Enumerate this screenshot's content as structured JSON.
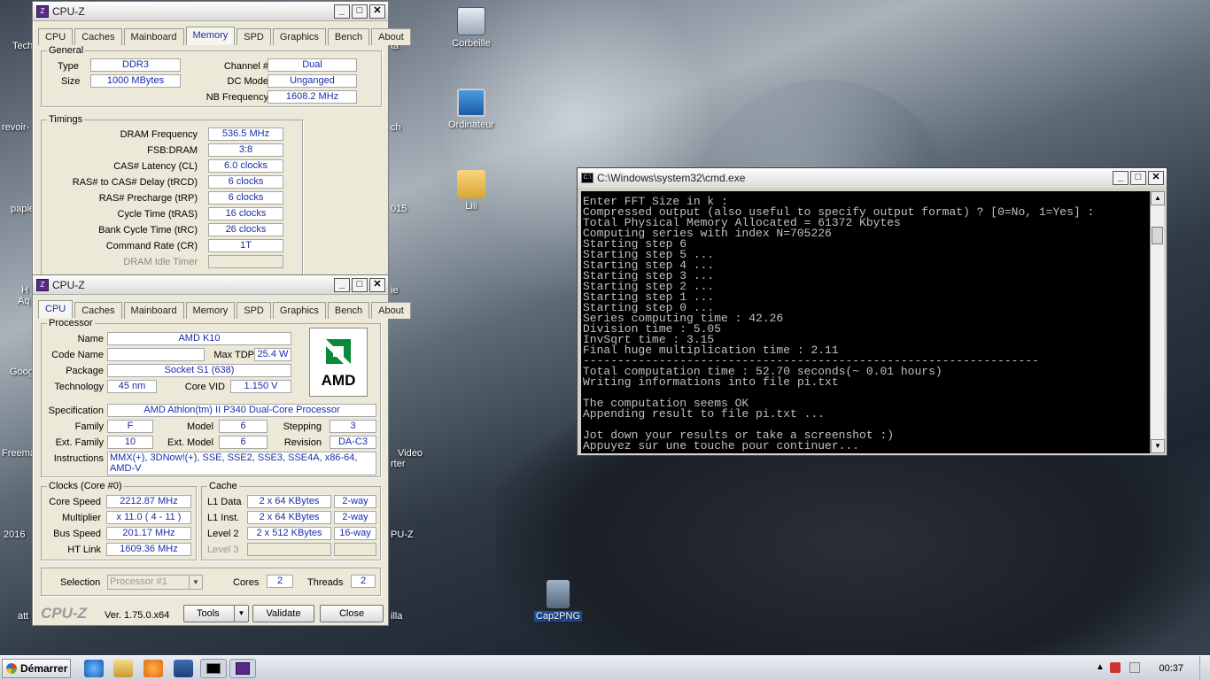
{
  "desktop": {
    "icons": [
      {
        "label": "Corbeille"
      },
      {
        "label": "Ordinateur"
      },
      {
        "label": "Lili"
      },
      {
        "label": "Cap2PNG"
      }
    ],
    "edge_labels": [
      "Tech",
      "revoir-",
      "papie",
      "H",
      "Aq",
      "Goog",
      "Freema",
      "2016",
      "att",
      "ta",
      "ch",
      "015",
      "ie",
      "Video",
      "rter",
      "PU-Z",
      "illa"
    ]
  },
  "cpuz_memory": {
    "title": "CPU-Z",
    "tabs": [
      "CPU",
      "Caches",
      "Mainboard",
      "Memory",
      "SPD",
      "Graphics",
      "Bench",
      "About"
    ],
    "active_tab": "Memory",
    "general": {
      "label": "General",
      "type_label": "Type",
      "type": "DDR3",
      "size_label": "Size",
      "size": "1000 MBytes",
      "channel_label": "Channel #",
      "channel": "Dual",
      "dcmode_label": "DC Mode",
      "dcmode": "Unganged",
      "nbfreq_label": "NB Frequency",
      "nbfreq": "1608.2 MHz"
    },
    "timings": {
      "label": "Timings",
      "rows": [
        {
          "label": "DRAM Frequency",
          "value": "536.5 MHz"
        },
        {
          "label": "FSB:DRAM",
          "value": "3:8"
        },
        {
          "label": "CAS# Latency (CL)",
          "value": "6.0 clocks"
        },
        {
          "label": "RAS# to CAS# Delay (tRCD)",
          "value": "6 clocks"
        },
        {
          "label": "RAS# Precharge (tRP)",
          "value": "6 clocks"
        },
        {
          "label": "Cycle Time (tRAS)",
          "value": "16 clocks"
        },
        {
          "label": "Bank Cycle Time (tRC)",
          "value": "26 clocks"
        },
        {
          "label": "Command Rate (CR)",
          "value": "1T"
        },
        {
          "label": "DRAM Idle Timer",
          "value": ""
        }
      ]
    }
  },
  "cpuz_cpu": {
    "title": "CPU-Z",
    "tabs": [
      "CPU",
      "Caches",
      "Mainboard",
      "Memory",
      "SPD",
      "Graphics",
      "Bench",
      "About"
    ],
    "active_tab": "CPU",
    "processor": {
      "label": "Processor",
      "name_label": "Name",
      "name": "AMD K10",
      "codename_label": "Code Name",
      "codename": "",
      "maxtdp_label": "Max TDP",
      "maxtdp": "25.4 W",
      "package_label": "Package",
      "package": "Socket S1 (638)",
      "technology_label": "Technology",
      "technology": "45 nm",
      "corevid_label": "Core VID",
      "corevid": "1.150 V",
      "spec_label": "Specification",
      "spec": "AMD Athlon(tm) II P340 Dual-Core Processor",
      "family_label": "Family",
      "family": "F",
      "model_label": "Model",
      "model": "6",
      "stepping_label": "Stepping",
      "stepping": "3",
      "extfamily_label": "Ext. Family",
      "extfamily": "10",
      "extmodel_label": "Ext. Model",
      "extmodel": "6",
      "revision_label": "Revision",
      "revision": "DA-C3",
      "instr_label": "Instructions",
      "instr": "MMX(+), 3DNow!(+), SSE, SSE2, SSE3, SSE4A, x86-64, AMD-V",
      "logo_text": "AMD"
    },
    "clocks": {
      "label": "Clocks (Core #0)",
      "corespeed_label": "Core Speed",
      "corespeed": "2212.87 MHz",
      "multiplier_label": "Multiplier",
      "multiplier": "x 11.0 ( 4 - 11 )",
      "busspeed_label": "Bus Speed",
      "busspeed": "201.17 MHz",
      "htlink_label": "HT Link",
      "htlink": "1609.36 MHz"
    },
    "cache": {
      "label": "Cache",
      "rows": [
        {
          "label": "L1 Data",
          "size": "2 x 64 KBytes",
          "way": "2-way"
        },
        {
          "label": "L1 Inst.",
          "size": "2 x 64 KBytes",
          "way": "2-way"
        },
        {
          "label": "Level 2",
          "size": "2 x 512 KBytes",
          "way": "16-way"
        },
        {
          "label": "Level 3",
          "size": "",
          "way": ""
        }
      ]
    },
    "selection_label": "Selection",
    "selection": "Processor #1",
    "cores_label": "Cores",
    "cores": "2",
    "threads_label": "Threads",
    "threads": "2",
    "brand": "CPU-Z",
    "version": "Ver. 1.75.0.x64",
    "tools_label": "Tools",
    "validate_label": "Validate",
    "close_label": "Close"
  },
  "cmd": {
    "title": "C:\\Windows\\system32\\cmd.exe",
    "lines": [
      "Enter FFT Size in k :",
      "Compressed output (also useful to specify output format) ? [0=No, 1=Yes] :",
      "Total Physical Memory Allocated = 61372 Kbytes",
      "Computing series with index N=705226",
      "Starting step 6",
      "Starting step 5 ...",
      "Starting step 4 ...",
      "Starting step 3 ...",
      "Starting step 2 ...",
      "Starting step 1 ...",
      "Starting step 0 ...",
      "Series computing time : 42.26",
      "Division time : 5.05",
      "InvSqrt time : 3.15",
      "Final huge multiplication time : 2.11",
      "------------------------------------------------------------------",
      "Total computation time : 52.70 seconds(~ 0.01 hours)",
      "Writing informations into file pi.txt",
      "",
      "The computation seems OK",
      "Appending result to file pi.txt ...",
      "",
      "Jot down your results or take a screenshot :)",
      "Appuyez sur une touche pour continuer..."
    ]
  },
  "taskbar": {
    "start_label": "Démarrer",
    "clock": "00:37"
  }
}
